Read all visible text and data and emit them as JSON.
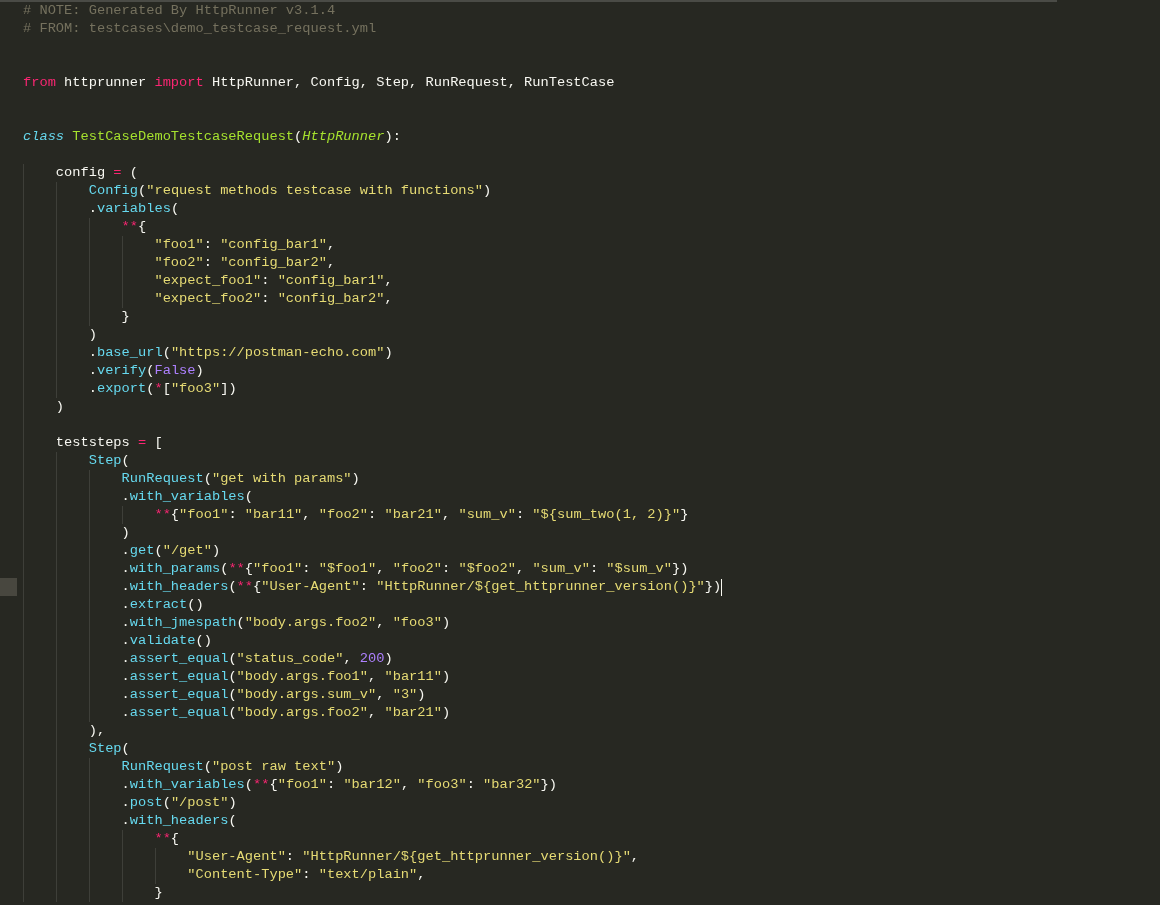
{
  "editor": {
    "lines": [
      {
        "kind": "code",
        "current": false,
        "tokens": [
          {
            "kind": "comment",
            "text": "# NOTE: Generated By HttpRunner v3.1.4"
          }
        ]
      },
      {
        "kind": "code",
        "current": false,
        "tokens": [
          {
            "kind": "comment",
            "text": "# FROM: testcases\\demo_testcase_request.yml"
          }
        ]
      },
      {
        "kind": "blank",
        "current": false
      },
      {
        "kind": "blank",
        "current": false
      },
      {
        "kind": "code",
        "current": false,
        "tokens": [
          {
            "kind": "keyword",
            "text": "from"
          },
          {
            "kind": "plain",
            "text": " httprunner "
          },
          {
            "kind": "keyword",
            "text": "import"
          },
          {
            "kind": "plain",
            "text": " HttpRunner, Config, Step, RunRequest, RunTestCase"
          }
        ]
      },
      {
        "kind": "blank",
        "current": false
      },
      {
        "kind": "blank",
        "current": false
      },
      {
        "kind": "code",
        "current": false,
        "tokens": [
          {
            "kind": "storage",
            "text": "class "
          },
          {
            "kind": "entity",
            "text": "TestCaseDemoTestcaseRequest"
          },
          {
            "kind": "plain",
            "text": "("
          },
          {
            "kind": "inherit",
            "text": "HttpRunner"
          },
          {
            "kind": "plain",
            "text": "):"
          }
        ]
      },
      {
        "kind": "blank",
        "current": false
      },
      {
        "kind": "code",
        "current": false,
        "tokens": [
          {
            "kind": "plain",
            "text": "    config "
          },
          {
            "kind": "operator",
            "text": "="
          },
          {
            "kind": "plain",
            "text": " ("
          }
        ]
      },
      {
        "kind": "code",
        "current": false,
        "tokens": [
          {
            "kind": "func",
            "text": "        Config"
          },
          {
            "kind": "plain",
            "text": "("
          },
          {
            "kind": "string",
            "text": "\"request methods testcase with functions\""
          },
          {
            "kind": "plain",
            "text": ")"
          }
        ]
      },
      {
        "kind": "code",
        "current": false,
        "tokens": [
          {
            "kind": "plain",
            "text": "        ."
          },
          {
            "kind": "func",
            "text": "variables"
          },
          {
            "kind": "plain",
            "text": "("
          }
        ]
      },
      {
        "kind": "code",
        "current": false,
        "tokens": [
          {
            "kind": "operator",
            "text": "            **"
          },
          {
            "kind": "plain",
            "text": "{"
          }
        ]
      },
      {
        "kind": "code",
        "current": false,
        "tokens": [
          {
            "kind": "string",
            "text": "                \"foo1\""
          },
          {
            "kind": "plain",
            "text": ": "
          },
          {
            "kind": "string",
            "text": "\"config_bar1\""
          },
          {
            "kind": "plain",
            "text": ","
          }
        ]
      },
      {
        "kind": "code",
        "current": false,
        "tokens": [
          {
            "kind": "string",
            "text": "                \"foo2\""
          },
          {
            "kind": "plain",
            "text": ": "
          },
          {
            "kind": "string",
            "text": "\"config_bar2\""
          },
          {
            "kind": "plain",
            "text": ","
          }
        ]
      },
      {
        "kind": "code",
        "current": false,
        "tokens": [
          {
            "kind": "string",
            "text": "                \"expect_foo1\""
          },
          {
            "kind": "plain",
            "text": ": "
          },
          {
            "kind": "string",
            "text": "\"config_bar1\""
          },
          {
            "kind": "plain",
            "text": ","
          }
        ]
      },
      {
        "kind": "code",
        "current": false,
        "tokens": [
          {
            "kind": "string",
            "text": "                \"expect_foo2\""
          },
          {
            "kind": "plain",
            "text": ": "
          },
          {
            "kind": "string",
            "text": "\"config_bar2\""
          },
          {
            "kind": "plain",
            "text": ","
          }
        ]
      },
      {
        "kind": "code",
        "current": false,
        "tokens": [
          {
            "kind": "plain",
            "text": "            }"
          }
        ]
      },
      {
        "kind": "code",
        "current": false,
        "tokens": [
          {
            "kind": "plain",
            "text": "        )"
          }
        ]
      },
      {
        "kind": "code",
        "current": false,
        "tokens": [
          {
            "kind": "plain",
            "text": "        ."
          },
          {
            "kind": "func",
            "text": "base_url"
          },
          {
            "kind": "plain",
            "text": "("
          },
          {
            "kind": "string",
            "text": "\"https://postman-echo.com\""
          },
          {
            "kind": "plain",
            "text": ")"
          }
        ]
      },
      {
        "kind": "code",
        "current": false,
        "tokens": [
          {
            "kind": "plain",
            "text": "        ."
          },
          {
            "kind": "func",
            "text": "verify"
          },
          {
            "kind": "plain",
            "text": "("
          },
          {
            "kind": "constant",
            "text": "False"
          },
          {
            "kind": "plain",
            "text": ")"
          }
        ]
      },
      {
        "kind": "code",
        "current": false,
        "tokens": [
          {
            "kind": "plain",
            "text": "        ."
          },
          {
            "kind": "func",
            "text": "export"
          },
          {
            "kind": "plain",
            "text": "("
          },
          {
            "kind": "operator",
            "text": "*"
          },
          {
            "kind": "plain",
            "text": "["
          },
          {
            "kind": "string",
            "text": "\"foo3\""
          },
          {
            "kind": "plain",
            "text": "])"
          }
        ]
      },
      {
        "kind": "code",
        "current": false,
        "tokens": [
          {
            "kind": "plain",
            "text": "    )"
          }
        ]
      },
      {
        "kind": "blank",
        "current": false
      },
      {
        "kind": "code",
        "current": false,
        "tokens": [
          {
            "kind": "plain",
            "text": "    teststeps "
          },
          {
            "kind": "operator",
            "text": "="
          },
          {
            "kind": "plain",
            "text": " ["
          }
        ]
      },
      {
        "kind": "code",
        "current": false,
        "tokens": [
          {
            "kind": "func",
            "text": "        Step"
          },
          {
            "kind": "plain",
            "text": "("
          }
        ]
      },
      {
        "kind": "code",
        "current": false,
        "tokens": [
          {
            "kind": "func",
            "text": "            RunRequest"
          },
          {
            "kind": "plain",
            "text": "("
          },
          {
            "kind": "string",
            "text": "\"get with params\""
          },
          {
            "kind": "plain",
            "text": ")"
          }
        ]
      },
      {
        "kind": "code",
        "current": false,
        "tokens": [
          {
            "kind": "plain",
            "text": "            ."
          },
          {
            "kind": "func",
            "text": "with_variables"
          },
          {
            "kind": "plain",
            "text": "("
          }
        ]
      },
      {
        "kind": "code",
        "current": false,
        "tokens": [
          {
            "kind": "operator",
            "text": "                **"
          },
          {
            "kind": "plain",
            "text": "{"
          },
          {
            "kind": "string",
            "text": "\"foo1\""
          },
          {
            "kind": "plain",
            "text": ": "
          },
          {
            "kind": "string",
            "text": "\"bar11\""
          },
          {
            "kind": "plain",
            "text": ", "
          },
          {
            "kind": "string",
            "text": "\"foo2\""
          },
          {
            "kind": "plain",
            "text": ": "
          },
          {
            "kind": "string",
            "text": "\"bar21\""
          },
          {
            "kind": "plain",
            "text": ", "
          },
          {
            "kind": "string",
            "text": "\"sum_v\""
          },
          {
            "kind": "plain",
            "text": ": "
          },
          {
            "kind": "string",
            "text": "\"${sum_two(1, 2)}\""
          },
          {
            "kind": "plain",
            "text": "}"
          }
        ]
      },
      {
        "kind": "code",
        "current": false,
        "tokens": [
          {
            "kind": "plain",
            "text": "            )"
          }
        ]
      },
      {
        "kind": "code",
        "current": false,
        "tokens": [
          {
            "kind": "plain",
            "text": "            ."
          },
          {
            "kind": "func",
            "text": "get"
          },
          {
            "kind": "plain",
            "text": "("
          },
          {
            "kind": "string",
            "text": "\"/get\""
          },
          {
            "kind": "plain",
            "text": ")"
          }
        ]
      },
      {
        "kind": "code",
        "current": false,
        "tokens": [
          {
            "kind": "plain",
            "text": "            ."
          },
          {
            "kind": "func",
            "text": "with_params"
          },
          {
            "kind": "plain",
            "text": "("
          },
          {
            "kind": "operator",
            "text": "**"
          },
          {
            "kind": "plain",
            "text": "{"
          },
          {
            "kind": "string",
            "text": "\"foo1\""
          },
          {
            "kind": "plain",
            "text": ": "
          },
          {
            "kind": "string",
            "text": "\"$foo1\""
          },
          {
            "kind": "plain",
            "text": ", "
          },
          {
            "kind": "string",
            "text": "\"foo2\""
          },
          {
            "kind": "plain",
            "text": ": "
          },
          {
            "kind": "string",
            "text": "\"$foo2\""
          },
          {
            "kind": "plain",
            "text": ", "
          },
          {
            "kind": "string",
            "text": "\"sum_v\""
          },
          {
            "kind": "plain",
            "text": ": "
          },
          {
            "kind": "string",
            "text": "\"$sum_v\""
          },
          {
            "kind": "plain",
            "text": "})"
          }
        ]
      },
      {
        "kind": "code",
        "current": true,
        "tokens": [
          {
            "kind": "plain",
            "text": "            ."
          },
          {
            "kind": "func",
            "text": "with_headers"
          },
          {
            "kind": "plain",
            "text": "("
          },
          {
            "kind": "operator",
            "text": "**"
          },
          {
            "kind": "plain",
            "text": "{"
          },
          {
            "kind": "string",
            "text": "\"User-Agent\""
          },
          {
            "kind": "plain",
            "text": ": "
          },
          {
            "kind": "string",
            "text": "\"HttpRunner/${get_httprunner_version()}\""
          },
          {
            "kind": "plain",
            "text": "})"
          }
        ]
      },
      {
        "kind": "code",
        "current": false,
        "tokens": [
          {
            "kind": "plain",
            "text": "            ."
          },
          {
            "kind": "func",
            "text": "extract"
          },
          {
            "kind": "plain",
            "text": "()"
          }
        ]
      },
      {
        "kind": "code",
        "current": false,
        "tokens": [
          {
            "kind": "plain",
            "text": "            ."
          },
          {
            "kind": "func",
            "text": "with_jmespath"
          },
          {
            "kind": "plain",
            "text": "("
          },
          {
            "kind": "string",
            "text": "\"body.args.foo2\""
          },
          {
            "kind": "plain",
            "text": ", "
          },
          {
            "kind": "string",
            "text": "\"foo3\""
          },
          {
            "kind": "plain",
            "text": ")"
          }
        ]
      },
      {
        "kind": "code",
        "current": false,
        "tokens": [
          {
            "kind": "plain",
            "text": "            ."
          },
          {
            "kind": "func",
            "text": "validate"
          },
          {
            "kind": "plain",
            "text": "()"
          }
        ]
      },
      {
        "kind": "code",
        "current": false,
        "tokens": [
          {
            "kind": "plain",
            "text": "            ."
          },
          {
            "kind": "func",
            "text": "assert_equal"
          },
          {
            "kind": "plain",
            "text": "("
          },
          {
            "kind": "string",
            "text": "\"status_code\""
          },
          {
            "kind": "plain",
            "text": ", "
          },
          {
            "kind": "constant",
            "text": "200"
          },
          {
            "kind": "plain",
            "text": ")"
          }
        ]
      },
      {
        "kind": "code",
        "current": false,
        "tokens": [
          {
            "kind": "plain",
            "text": "            ."
          },
          {
            "kind": "func",
            "text": "assert_equal"
          },
          {
            "kind": "plain",
            "text": "("
          },
          {
            "kind": "string",
            "text": "\"body.args.foo1\""
          },
          {
            "kind": "plain",
            "text": ", "
          },
          {
            "kind": "string",
            "text": "\"bar11\""
          },
          {
            "kind": "plain",
            "text": ")"
          }
        ]
      },
      {
        "kind": "code",
        "current": false,
        "tokens": [
          {
            "kind": "plain",
            "text": "            ."
          },
          {
            "kind": "func",
            "text": "assert_equal"
          },
          {
            "kind": "plain",
            "text": "("
          },
          {
            "kind": "string",
            "text": "\"body.args.sum_v\""
          },
          {
            "kind": "plain",
            "text": ", "
          },
          {
            "kind": "string",
            "text": "\"3\""
          },
          {
            "kind": "plain",
            "text": ")"
          }
        ]
      },
      {
        "kind": "code",
        "current": false,
        "tokens": [
          {
            "kind": "plain",
            "text": "            ."
          },
          {
            "kind": "func",
            "text": "assert_equal"
          },
          {
            "kind": "plain",
            "text": "("
          },
          {
            "kind": "string",
            "text": "\"body.args.foo2\""
          },
          {
            "kind": "plain",
            "text": ", "
          },
          {
            "kind": "string",
            "text": "\"bar21\""
          },
          {
            "kind": "plain",
            "text": ")"
          }
        ]
      },
      {
        "kind": "code",
        "current": false,
        "tokens": [
          {
            "kind": "plain",
            "text": "        ),"
          }
        ]
      },
      {
        "kind": "code",
        "current": false,
        "tokens": [
          {
            "kind": "func",
            "text": "        Step"
          },
          {
            "kind": "plain",
            "text": "("
          }
        ]
      },
      {
        "kind": "code",
        "current": false,
        "tokens": [
          {
            "kind": "func",
            "text": "            RunRequest"
          },
          {
            "kind": "plain",
            "text": "("
          },
          {
            "kind": "string",
            "text": "\"post raw text\""
          },
          {
            "kind": "plain",
            "text": ")"
          }
        ]
      },
      {
        "kind": "code",
        "current": false,
        "tokens": [
          {
            "kind": "plain",
            "text": "            ."
          },
          {
            "kind": "func",
            "text": "with_variables"
          },
          {
            "kind": "plain",
            "text": "("
          },
          {
            "kind": "operator",
            "text": "**"
          },
          {
            "kind": "plain",
            "text": "{"
          },
          {
            "kind": "string",
            "text": "\"foo1\""
          },
          {
            "kind": "plain",
            "text": ": "
          },
          {
            "kind": "string",
            "text": "\"bar12\""
          },
          {
            "kind": "plain",
            "text": ", "
          },
          {
            "kind": "string",
            "text": "\"foo3\""
          },
          {
            "kind": "plain",
            "text": ": "
          },
          {
            "kind": "string",
            "text": "\"bar32\""
          },
          {
            "kind": "plain",
            "text": "})"
          }
        ]
      },
      {
        "kind": "code",
        "current": false,
        "tokens": [
          {
            "kind": "plain",
            "text": "            ."
          },
          {
            "kind": "func",
            "text": "post"
          },
          {
            "kind": "plain",
            "text": "("
          },
          {
            "kind": "string",
            "text": "\"/post\""
          },
          {
            "kind": "plain",
            "text": ")"
          }
        ]
      },
      {
        "kind": "code",
        "current": false,
        "tokens": [
          {
            "kind": "plain",
            "text": "            ."
          },
          {
            "kind": "func",
            "text": "with_headers"
          },
          {
            "kind": "plain",
            "text": "("
          }
        ]
      },
      {
        "kind": "code",
        "current": false,
        "tokens": [
          {
            "kind": "operator",
            "text": "                **"
          },
          {
            "kind": "plain",
            "text": "{"
          }
        ]
      },
      {
        "kind": "code",
        "current": false,
        "tokens": [
          {
            "kind": "string",
            "text": "                    \"User-Agent\""
          },
          {
            "kind": "plain",
            "text": ": "
          },
          {
            "kind": "string",
            "text": "\"HttpRunner/${get_httprunner_version()}\""
          },
          {
            "kind": "plain",
            "text": ","
          }
        ]
      },
      {
        "kind": "code",
        "current": false,
        "tokens": [
          {
            "kind": "string",
            "text": "                    \"Content-Type\""
          },
          {
            "kind": "plain",
            "text": ": "
          },
          {
            "kind": "string",
            "text": "\"text/plain\""
          },
          {
            "kind": "plain",
            "text": ","
          }
        ]
      },
      {
        "kind": "code",
        "current": false,
        "tokens": [
          {
            "kind": "plain",
            "text": "                }"
          }
        ]
      }
    ]
  }
}
